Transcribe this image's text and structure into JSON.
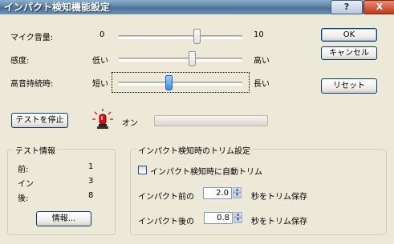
{
  "window": {
    "title": "インパクト検知機能設定",
    "help_label": "?",
    "close_label": "X"
  },
  "mic_volume": {
    "label": "マイク音量:",
    "min_label": "0",
    "max_label": "10",
    "level": 0.64
  },
  "sensitivity": {
    "label": "感度:",
    "min_label": "低い",
    "max_label": "高い",
    "level": 0.6
  },
  "high_pitch_duration": {
    "label": "高音持続時:",
    "min_label": "短い",
    "max_label": "長い",
    "level": 0.4
  },
  "buttons": {
    "ok": "OK",
    "cancel": "キャンセル",
    "reset": "リセット",
    "stop_test": "テストを停止",
    "info": "情報..."
  },
  "indicator": {
    "status": "オン",
    "color": "#e01010"
  },
  "test_info": {
    "title": "テスト情報",
    "rows": [
      {
        "label": "前:",
        "value": "1"
      },
      {
        "label": "イン",
        "value": "3"
      },
      {
        "label": "後:",
        "value": "8"
      }
    ]
  },
  "trim": {
    "title": "インパクト検知時のトリム設定",
    "auto_trim_label": "インパクト検知時に自動トリム",
    "auto_trim_checked": false,
    "before_label": "インパクト前の",
    "before_value": "2.0",
    "before_suffix": "秒をトリム保存",
    "after_label": "インパクト後の",
    "after_value": "0.8",
    "after_suffix": "秒をトリム保存"
  }
}
